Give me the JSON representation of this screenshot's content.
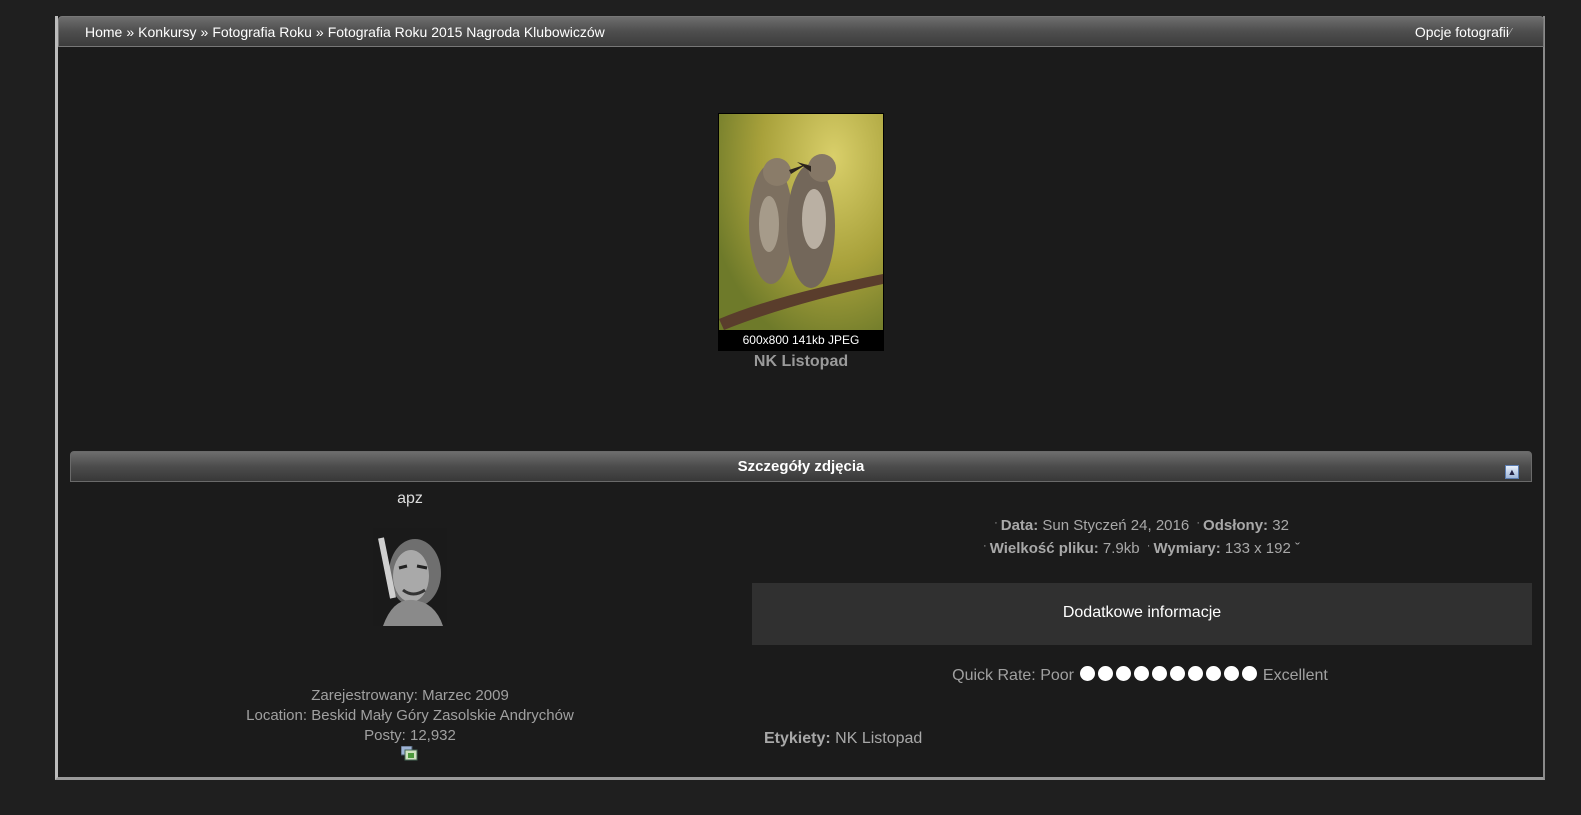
{
  "breadcrumb": {
    "items": [
      "Home",
      "Konkursy",
      "Fotografia Roku",
      "Fotografia Roku 2015 Nagroda Klubowiczów"
    ],
    "separator": "»"
  },
  "header": {
    "options_label": "Opcje fotografii"
  },
  "photo": {
    "info": "600x800 141kb JPEG",
    "caption": "NK Listopad"
  },
  "details": {
    "title": "Szczegóły zdjęcia",
    "user": {
      "name": "apz",
      "registered_label": "Zarejestrowany:",
      "registered_value": "Marzec 2009",
      "location_label": "Location:",
      "location_value": "Beskid Mały Góry Zasolskie Andrychów",
      "posts_label": "Posty:",
      "posts_value": "12,932"
    },
    "meta": {
      "date_label": "Data:",
      "date_value": "Sun Styczeń 24, 2016",
      "views_label": "Odsłony:",
      "views_value": "32",
      "filesize_label": "Wielkość pliku:",
      "filesize_value": "7.9kb",
      "dimensions_label": "Wymiary:",
      "dimensions_value": "133 x 192",
      "dimensions_toggle": "ˇ"
    },
    "extra_info_label": "Dodatkowe informacje",
    "quick_rate": {
      "label": "Quick Rate:",
      "low": "Poor",
      "high": "Excellent",
      "options": 10
    },
    "tags": {
      "label": "Etykiety:",
      "value": "NK Listopad"
    }
  },
  "colors": {
    "background": "#1f1f1f",
    "panel": "#1b1b1b",
    "bar": "#4e4e4e",
    "extra_box": "#303030"
  }
}
